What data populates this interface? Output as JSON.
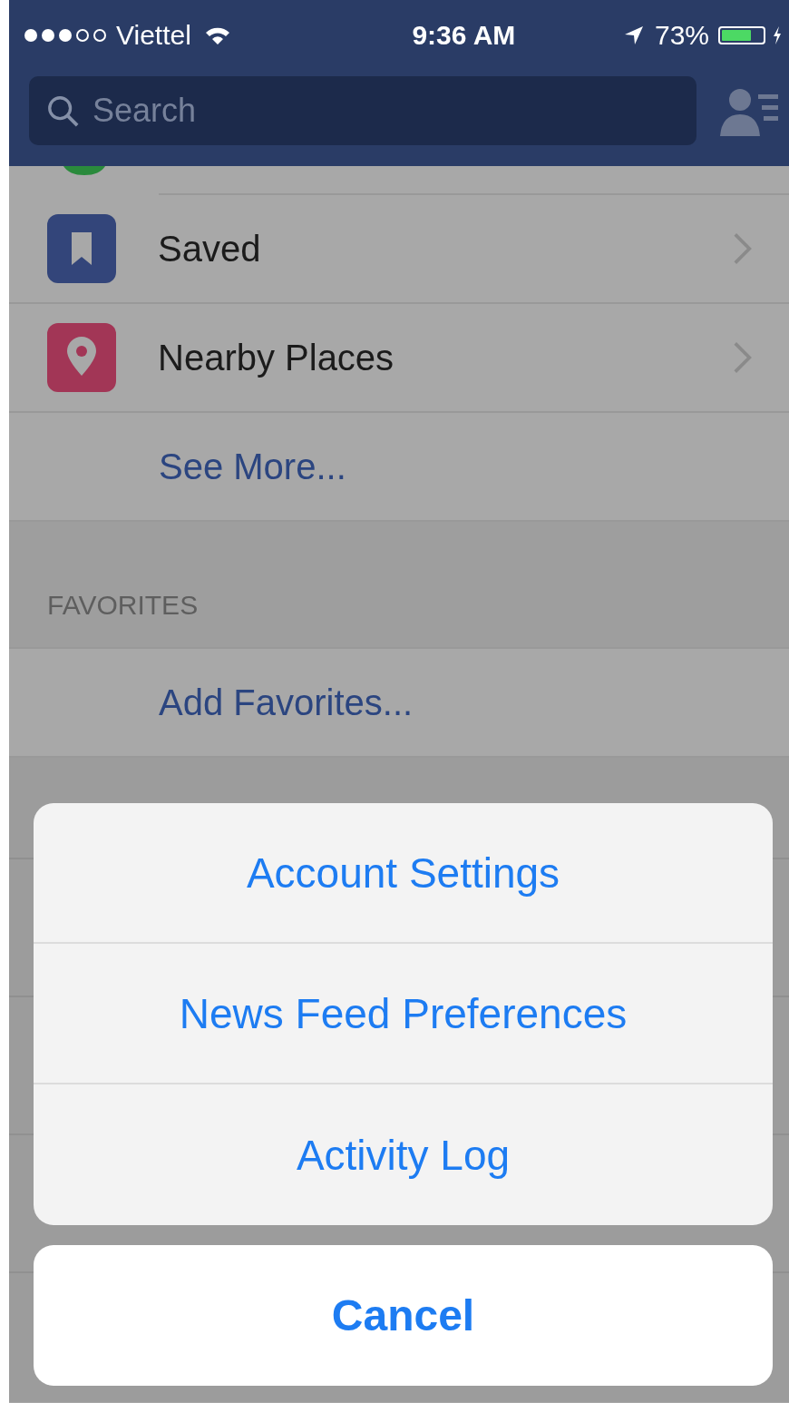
{
  "status_bar": {
    "carrier": "Viettel",
    "time": "9:36 AM",
    "battery_percent": "73%",
    "battery": {
      "level": 0.73
    }
  },
  "search": {
    "placeholder": "Search"
  },
  "menu_items": [
    {
      "label": "Saved",
      "kind": "saved"
    },
    {
      "label": "Nearby Places",
      "kind": "nearby"
    }
  ],
  "see_more": "See More...",
  "favorites": {
    "header": "FAVORITES",
    "add": "Add Favorites..."
  },
  "action_sheet": {
    "options": [
      "Account Settings",
      "News Feed Preferences",
      "Activity Log"
    ],
    "cancel": "Cancel"
  }
}
